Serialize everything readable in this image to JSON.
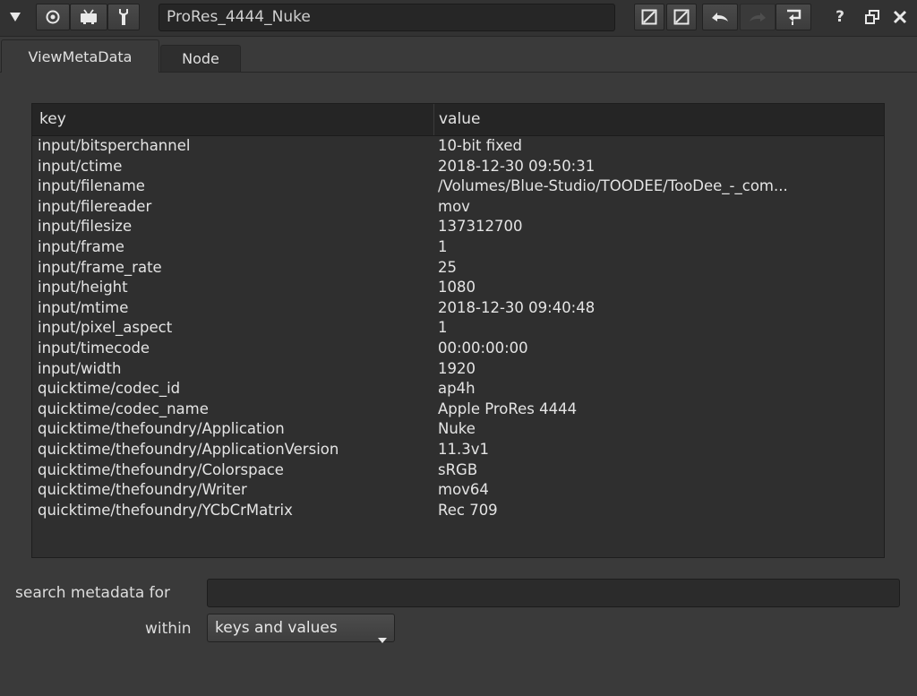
{
  "toolbar": {
    "node_name": "ProRes_4444_Nuke",
    "help_label": "?",
    "icons": [
      "collapse-triangle",
      "node-color",
      "node-monitor",
      "wrench",
      "compare-a",
      "compare-b",
      "undo",
      "redo",
      "revert",
      "help",
      "float-window",
      "close"
    ]
  },
  "tabs": [
    {
      "label": "ViewMetaData",
      "active": true
    },
    {
      "label": "Node",
      "active": false
    }
  ],
  "table": {
    "columns": [
      "key",
      "value"
    ],
    "rows": [
      [
        "input/bitsperchannel",
        "10-bit fixed"
      ],
      [
        "input/ctime",
        "2018-12-30 09:50:31"
      ],
      [
        "input/filename",
        "/Volumes/Blue-Studio/TOODEE/TooDee_-_com..."
      ],
      [
        "input/filereader",
        "mov"
      ],
      [
        "input/filesize",
        "137312700"
      ],
      [
        "input/frame",
        "1"
      ],
      [
        "input/frame_rate",
        "25"
      ],
      [
        "input/height",
        "1080"
      ],
      [
        "input/mtime",
        "2018-12-30 09:40:48"
      ],
      [
        "input/pixel_aspect",
        "1"
      ],
      [
        "input/timecode",
        "00:00:00:00"
      ],
      [
        "input/width",
        "1920"
      ],
      [
        "quicktime/codec_id",
        "ap4h"
      ],
      [
        "quicktime/codec_name",
        "Apple ProRes 4444"
      ],
      [
        "quicktime/thefoundry/Application",
        "Nuke"
      ],
      [
        "quicktime/thefoundry/ApplicationVersion",
        "11.3v1"
      ],
      [
        "quicktime/thefoundry/Colorspace",
        "sRGB"
      ],
      [
        "quicktime/thefoundry/Writer",
        "mov64"
      ],
      [
        "quicktime/thefoundry/YCbCrMatrix",
        "Rec 709"
      ]
    ]
  },
  "search": {
    "label": "search metadata for",
    "value": "",
    "placeholder": ""
  },
  "within": {
    "label": "within",
    "selected": "keys and values"
  },
  "colors": {
    "background": "#3a3a3a",
    "table_bg": "#2f2f2f",
    "header_bg": "#252525",
    "text": "#e4e4e4"
  }
}
